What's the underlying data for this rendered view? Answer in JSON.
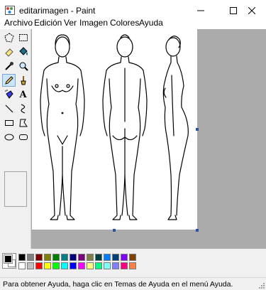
{
  "window": {
    "title": "editarimagen - Paint"
  },
  "menu": [
    "Archivo",
    "Edición",
    "Ver",
    "Imagen",
    "Colores",
    "Ayuda"
  ],
  "tools": [
    {
      "name": "free-select-icon"
    },
    {
      "name": "rect-select-icon"
    },
    {
      "name": "eraser-icon"
    },
    {
      "name": "fill-bucket-icon"
    },
    {
      "name": "eyedropper-icon"
    },
    {
      "name": "magnifier-icon"
    },
    {
      "name": "pencil-icon",
      "active": true
    },
    {
      "name": "brush-icon"
    },
    {
      "name": "airbrush-icon"
    },
    {
      "name": "text-icon",
      "glyph": "A"
    },
    {
      "name": "line-icon"
    },
    {
      "name": "curve-icon"
    },
    {
      "name": "rectangle-icon"
    },
    {
      "name": "polygon-icon"
    },
    {
      "name": "ellipse-icon"
    },
    {
      "name": "rounded-rectangle-icon"
    }
  ],
  "palette": {
    "row1": [
      "#000000",
      "#808080",
      "#800000",
      "#808000",
      "#008000",
      "#008080",
      "#000080",
      "#800080",
      "#808040",
      "#004040",
      "#0080ff",
      "#004080",
      "#8000ff",
      "#804000"
    ],
    "row2": [
      "#ffffff",
      "#c0c0c0",
      "#ff0000",
      "#ffff00",
      "#00ff00",
      "#00ffff",
      "#0000ff",
      "#ff00ff",
      "#ffff80",
      "#00ff80",
      "#80ffff",
      "#8080ff",
      "#ff0080",
      "#ff8040"
    ]
  },
  "status": {
    "text": "Para obtener Ayuda, haga clic en Temas de Ayuda en el menú Ayuda."
  }
}
